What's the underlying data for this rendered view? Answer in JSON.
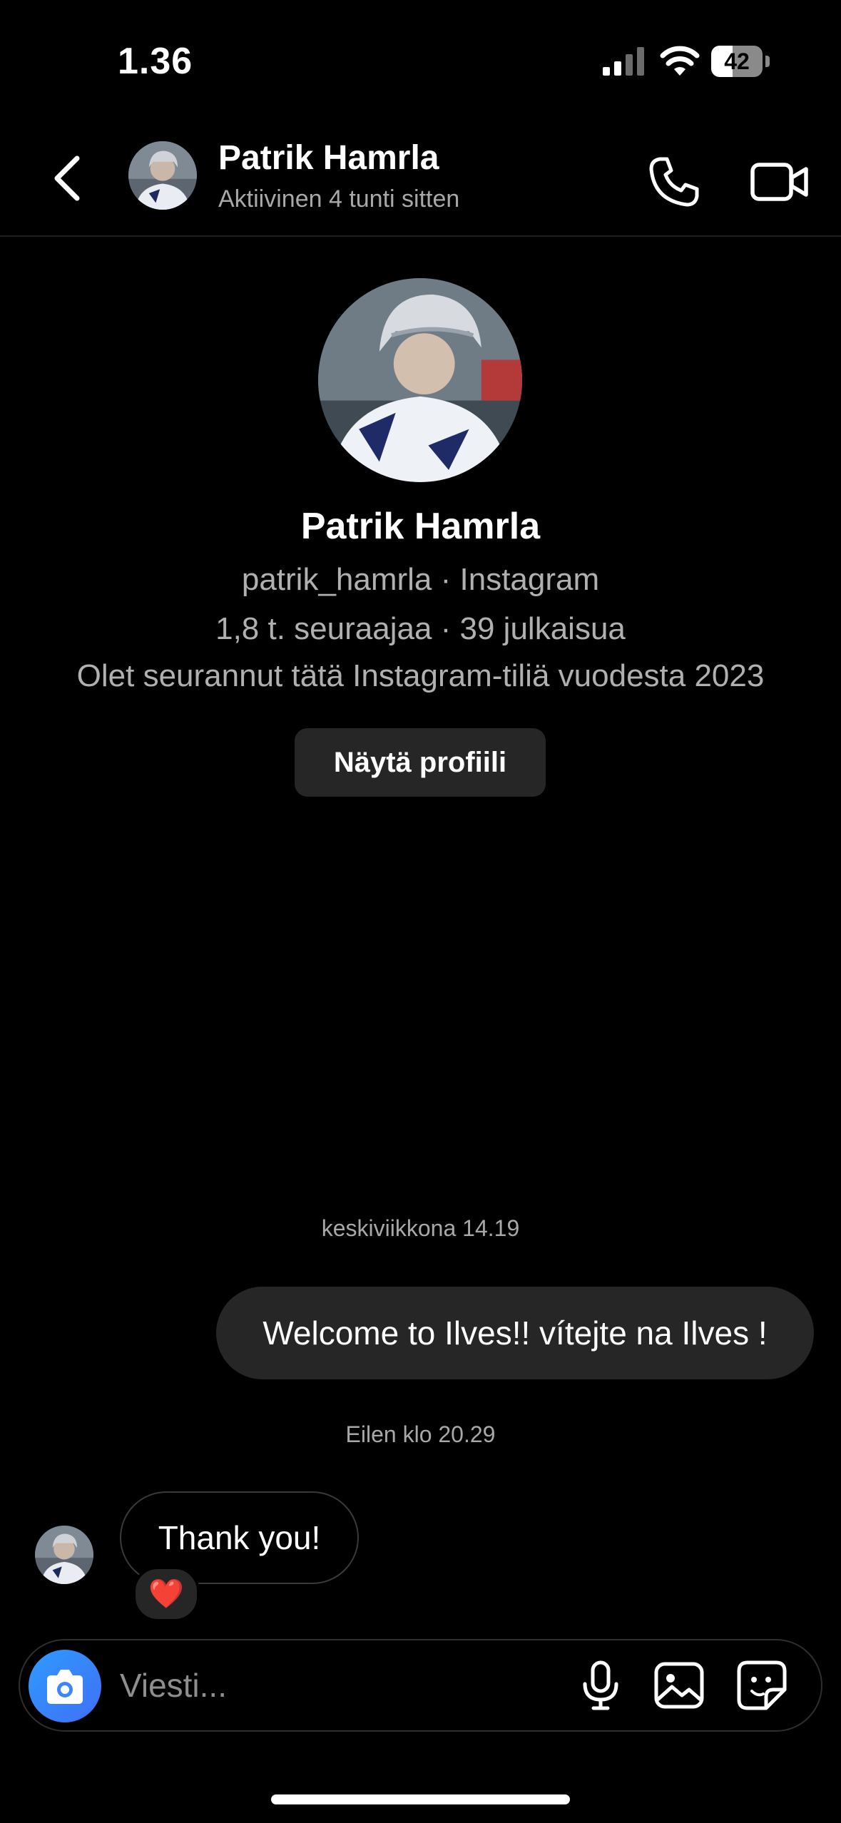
{
  "status_bar": {
    "time": "1.36",
    "battery_level": "42",
    "battery_fraction": 0.42
  },
  "header": {
    "back_icon": "chevron-left-icon",
    "contact_name": "Patrik Hamrla",
    "activity_status": "Aktiivinen 4 tunti sitten",
    "call_icon": "phone-icon",
    "video_icon": "video-camera-icon"
  },
  "profile": {
    "name": "Patrik Hamrla",
    "handle_line": "patrik_hamrla · Instagram",
    "stats_line": "1,8 t. seuraajaa · 39 julkaisua",
    "follow_info": "Olet seurannut tätä Instagram-tiliä vuodesta 2023",
    "view_profile_label": "Näytä profiili"
  },
  "messages": [
    {
      "timestamp": "keskiviikkona 14.19",
      "direction": "outgoing",
      "text": "Welcome to Ilves!! vítejte na Ilves !"
    },
    {
      "timestamp": "Eilen klo 20.29",
      "direction": "incoming",
      "text": "Thank you!",
      "reaction": "❤️"
    }
  ],
  "composer": {
    "placeholder": "Viesti...",
    "camera_icon": "camera-icon",
    "mic_icon": "microphone-icon",
    "gallery_icon": "image-icon",
    "sticker_icon": "sticker-icon"
  },
  "colors": {
    "background": "#000000",
    "bubble": "#262626",
    "secondary_text": "#a8a8a8",
    "camera_button": "#3a86ff"
  }
}
